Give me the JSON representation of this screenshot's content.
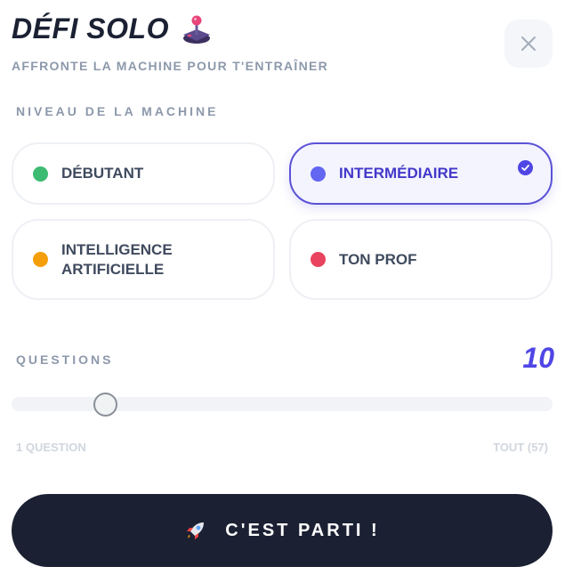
{
  "header": {
    "title": "DÉFI SOLO",
    "title_icon": "joystick-icon",
    "subtitle": "AFFRONTE LA MACHINE POUR T'ENTRAÎNER",
    "close_icon": "close-icon"
  },
  "level": {
    "label": "NIVEAU DE LA MACHINE",
    "selected": "INTERMÉDIAIRE",
    "options": [
      {
        "label": "DÉBUTANT",
        "color": "#3dbb72"
      },
      {
        "label": "INTERMÉDIAIRE",
        "color": "#6366f1"
      },
      {
        "label": "INTELLIGENCE\nARTIFICIELLE",
        "color": "#f59e0b"
      },
      {
        "label": "TON PROF",
        "color": "#e8445f"
      }
    ]
  },
  "questions": {
    "label": "QUESTIONS",
    "value": "10",
    "min_label": "1 QUESTION",
    "max_label": "TOUT (57)"
  },
  "start_button": {
    "icon": "rocket-icon",
    "label": "C'EST PARTI !"
  }
}
